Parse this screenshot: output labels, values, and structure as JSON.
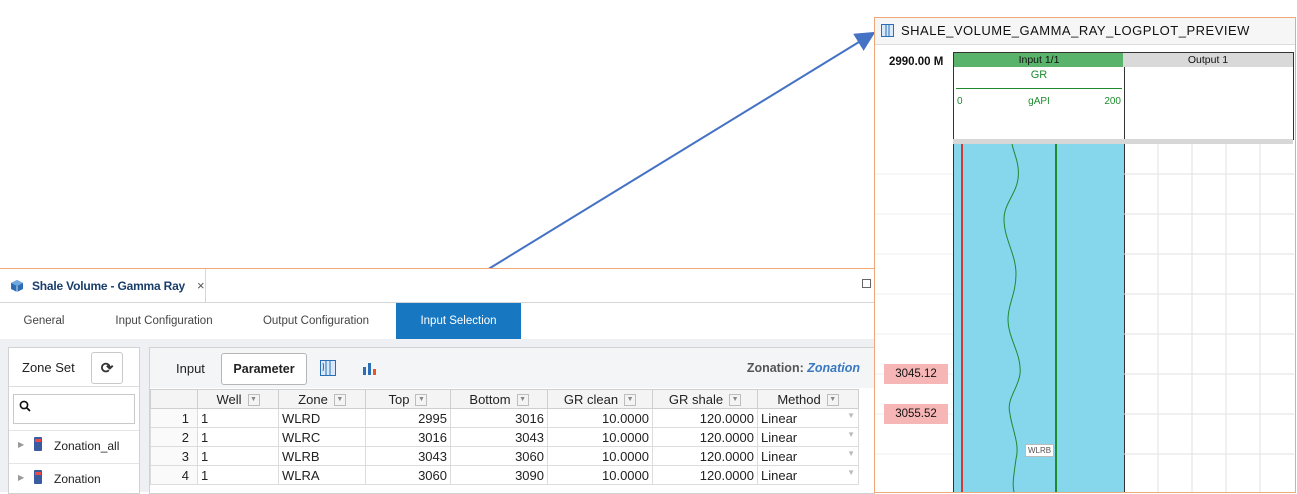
{
  "panel": {
    "doc_tab_title": "Shale Volume - Gamma Ray",
    "doc_tab_close": "×",
    "tabs": [
      {
        "label": "General",
        "active": false
      },
      {
        "label": "Input Configuration",
        "active": false
      },
      {
        "label": "Output Configuration",
        "active": false
      },
      {
        "label": "Input Selection",
        "active": true
      }
    ],
    "zone_set": {
      "label": "Zone Set",
      "search_icon": "🔍",
      "items": [
        {
          "label": "Zonation_all"
        },
        {
          "label": "Zonation"
        }
      ]
    },
    "toolbar": {
      "input_label": "Input",
      "parameter_label": "Parameter",
      "zonation_label": "Zonation:",
      "zonation_value": "Zonation"
    },
    "grid": {
      "headers": [
        "Well",
        "Zone",
        "Top",
        "Bottom",
        "GR clean",
        "GR shale",
        "Method"
      ],
      "rows": [
        {
          "idx": "1",
          "well": "1",
          "zone": "WLRD",
          "top": "2995",
          "bottom": "3016",
          "gr_clean": "10.0000",
          "gr_shale": "120.0000",
          "method": "Linear"
        },
        {
          "idx": "2",
          "well": "1",
          "zone": "WLRC",
          "top": "3016",
          "bottom": "3043",
          "gr_clean": "10.0000",
          "gr_shale": "120.0000",
          "method": "Linear"
        },
        {
          "idx": "3",
          "well": "1",
          "zone": "WLRB",
          "top": "3043",
          "bottom": "3060",
          "gr_clean": "10.0000",
          "gr_shale": "120.0000",
          "method": "Linear"
        },
        {
          "idx": "4",
          "well": "1",
          "zone": "WLRA",
          "top": "3060",
          "bottom": "3090",
          "gr_clean": "10.0000",
          "gr_shale": "120.0000",
          "method": "Linear"
        }
      ]
    }
  },
  "preview": {
    "title": "SHALE_VOLUME_GAMMA_RAY_LOGPLOT_PREVIEW",
    "depth_top": "2990.00 M",
    "track1_title": "Input 1/1",
    "track2_title": "Output 1",
    "curve_name": "GR",
    "scale_min": "0",
    "scale_unit": "gAPI",
    "scale_max": "200",
    "depth_marks": [
      "3045.12",
      "3055.52"
    ],
    "zone_tag": "WLRB",
    "colors": {
      "track_fill": "#86d6ec",
      "curve": "#1f8a2e",
      "tab_active": "#1777c1"
    }
  }
}
